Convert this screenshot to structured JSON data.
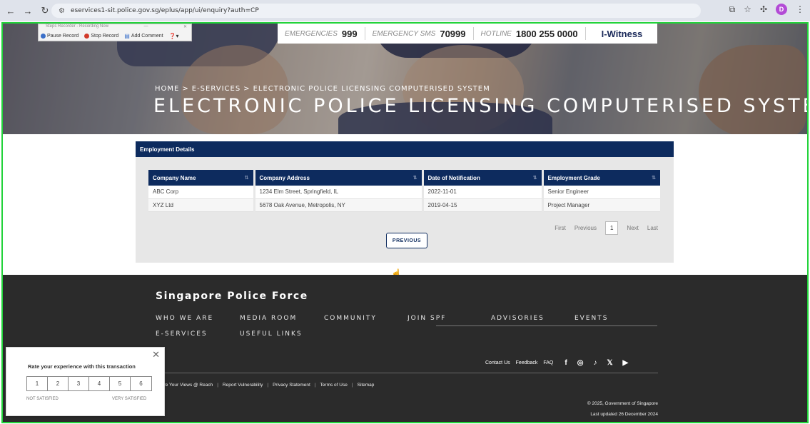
{
  "browser": {
    "url": "eservices1-sit.police.gov.sg/eplus/app/ui/enquiry?auth=CP",
    "profile_initial": "D"
  },
  "recorder": {
    "title": "Steps Recorder - Recording Now",
    "pause": "Pause Record",
    "stop": "Stop Record",
    "comment": "Add Comment"
  },
  "topbar": {
    "emergencies_label": "EMERGENCIES",
    "emergencies_value": "999",
    "sms_label": "EMERGENCY SMS",
    "sms_value": "70999",
    "hotline_label": "HOTLINE",
    "hotline_value": "1800 255 0000",
    "iwitness": "I-Witness"
  },
  "hero": {
    "breadcrumb": [
      "HOME",
      "E-SERVICES",
      "ELECTRONIC POLICE LICENSING COMPUTERISED SYSTEM"
    ],
    "breadcrumb_sep": ">",
    "title": "ELECTRONIC POLICE LICENSING COMPUTERISED SYSTEM"
  },
  "employment": {
    "heading": "Employment Details",
    "columns": [
      "Company Name",
      "Company Address",
      "Date of Notification",
      "Employment Grade"
    ],
    "rows": [
      [
        "ABC Corp",
        "1234 Elm Street, Springfield, IL",
        "2022-11-01",
        "Senior Engineer"
      ],
      [
        "XYZ Ltd",
        "5678 Oak Avenue, Metropolis, NY",
        "2019-04-15",
        "Project Manager"
      ]
    ],
    "pager": {
      "first": "First",
      "previous": "Previous",
      "current": "1",
      "next": "Next",
      "last": "Last"
    },
    "previous_button": "PREVIOUS"
  },
  "footer": {
    "title": "Singapore Police Force",
    "links": [
      "WHO WE ARE",
      "MEDIA ROOM",
      "COMMUNITY",
      "JOIN SPF",
      "ADVISORIES",
      "EVENTS",
      "E-SERVICES",
      "USEFUL LINKS"
    ],
    "contact": [
      "Contact Us",
      "Feedback",
      "FAQ"
    ],
    "social_icons": [
      "facebook-icon",
      "instagram-icon",
      "tiktok-icon",
      "x-icon",
      "youtube-icon"
    ],
    "bottom_links": [
      "Share Your Views @ Reach",
      "Report Vulnerability",
      "Privacy Statement",
      "Terms of Use",
      "Sitemap"
    ],
    "copyright": "© 2025, Government of Singapore",
    "updated": "Last updated 26 December 2024"
  },
  "rating": {
    "title": "Rate your experience with this transaction",
    "options": [
      "1",
      "2",
      "3",
      "4",
      "5",
      "6"
    ],
    "low_label": "NOT SATISFIED",
    "high_label": "VERY SATISFIED"
  },
  "colors": {
    "navy": "#0d2b5e",
    "footer_bg": "#2b2b2b",
    "frame_green": "#22d33a"
  }
}
